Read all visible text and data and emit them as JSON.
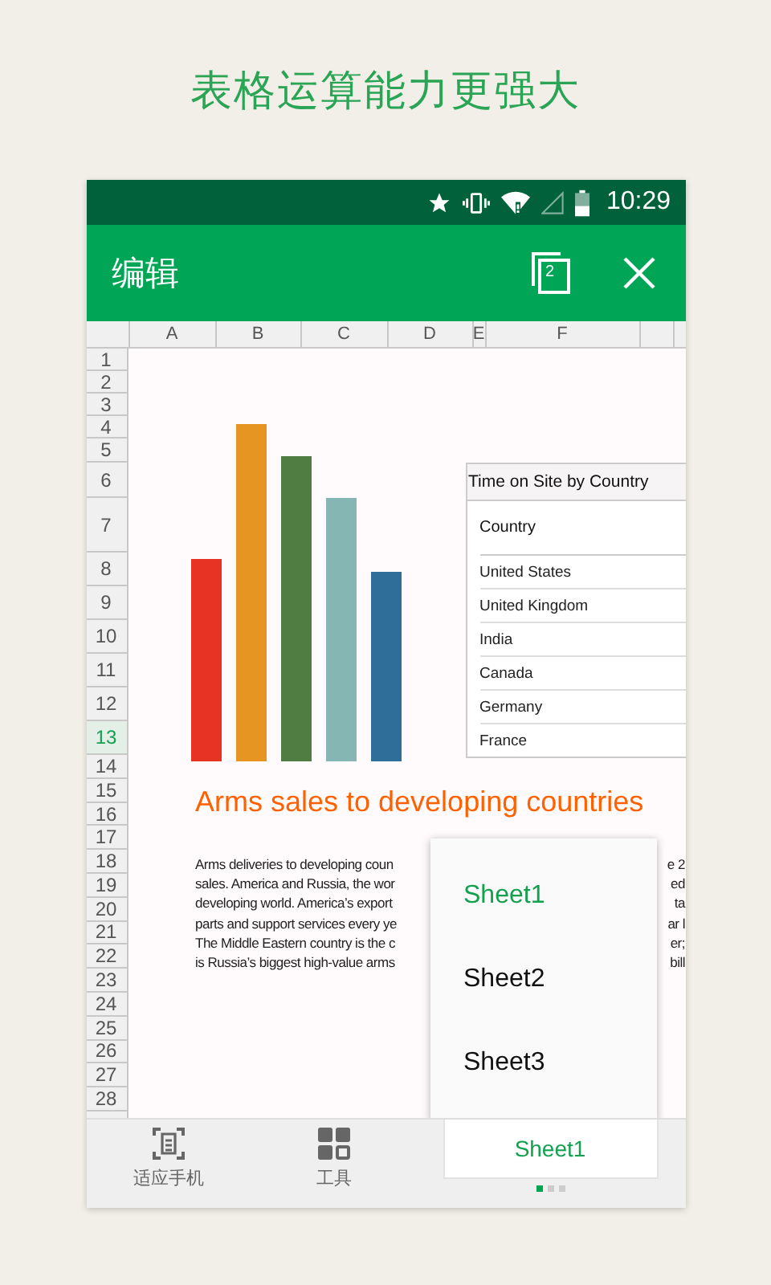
{
  "headline": "表格运算能力更强大",
  "status_bar": {
    "time": "10:29"
  },
  "app_bar": {
    "title": "编辑",
    "window_count": "2"
  },
  "columns": [
    {
      "label": "A"
    },
    {
      "label": "B"
    },
    {
      "label": "C"
    },
    {
      "label": "D"
    },
    {
      "label": "E"
    },
    {
      "label": "F"
    }
  ],
  "rows": [
    {
      "label": "1",
      "selected": false
    },
    {
      "label": "2",
      "selected": false
    },
    {
      "label": "3",
      "selected": false
    },
    {
      "label": "4",
      "selected": false
    },
    {
      "label": "5",
      "selected": false
    },
    {
      "label": "6",
      "selected": false
    },
    {
      "label": "7",
      "selected": false
    },
    {
      "label": "8",
      "selected": false
    },
    {
      "label": "9",
      "selected": false
    },
    {
      "label": "10",
      "selected": false
    },
    {
      "label": "11",
      "selected": false
    },
    {
      "label": "12",
      "selected": false
    },
    {
      "label": "13",
      "selected": true
    },
    {
      "label": "14",
      "selected": false
    },
    {
      "label": "15",
      "selected": false
    },
    {
      "label": "16",
      "selected": false
    },
    {
      "label": "17",
      "selected": false
    },
    {
      "label": "18",
      "selected": false
    },
    {
      "label": "19",
      "selected": false
    },
    {
      "label": "20",
      "selected": false
    },
    {
      "label": "21",
      "selected": false
    },
    {
      "label": "22",
      "selected": false
    },
    {
      "label": "23",
      "selected": false
    },
    {
      "label": "24",
      "selected": false
    },
    {
      "label": "25",
      "selected": false
    },
    {
      "label": "26",
      "selected": false
    },
    {
      "label": "27",
      "selected": false
    },
    {
      "label": "28",
      "selected": false
    }
  ],
  "table": {
    "title": "Time on Site by Country",
    "header": "Country",
    "rows": [
      "United States",
      "United Kingdom",
      "India",
      "Canada",
      "Germany",
      "France"
    ]
  },
  "title": "Arms sales to developing countries",
  "paragraph": [
    {
      "left": "Arms deliveries to developing coun",
      "right": "e 2"
    },
    {
      "left": "sales. America and Russia, the wor",
      "right": "ed"
    },
    {
      "left": "developing world. America’s export",
      "right": "ta"
    },
    {
      "left": "parts and support services every ye",
      "right": "ar l"
    },
    {
      "left": "The Middle Eastern country is the c",
      "right": "er;"
    },
    {
      "left": "is Russia’s biggest high-value arms",
      "right": "bill"
    }
  ],
  "sheet_menu": [
    {
      "label": "Sheet1",
      "selected": true
    },
    {
      "label": "Sheet2",
      "selected": false
    },
    {
      "label": "Sheet3",
      "selected": false
    }
  ],
  "toolbar": [
    {
      "kind": "fit",
      "label": "适应手机"
    },
    {
      "kind": "tools",
      "label": "工具"
    }
  ],
  "sheet_tab": {
    "label": "Sheet1"
  },
  "pager": [
    {
      "selected": true
    },
    {
      "selected": false
    },
    {
      "selected": false
    }
  ]
}
